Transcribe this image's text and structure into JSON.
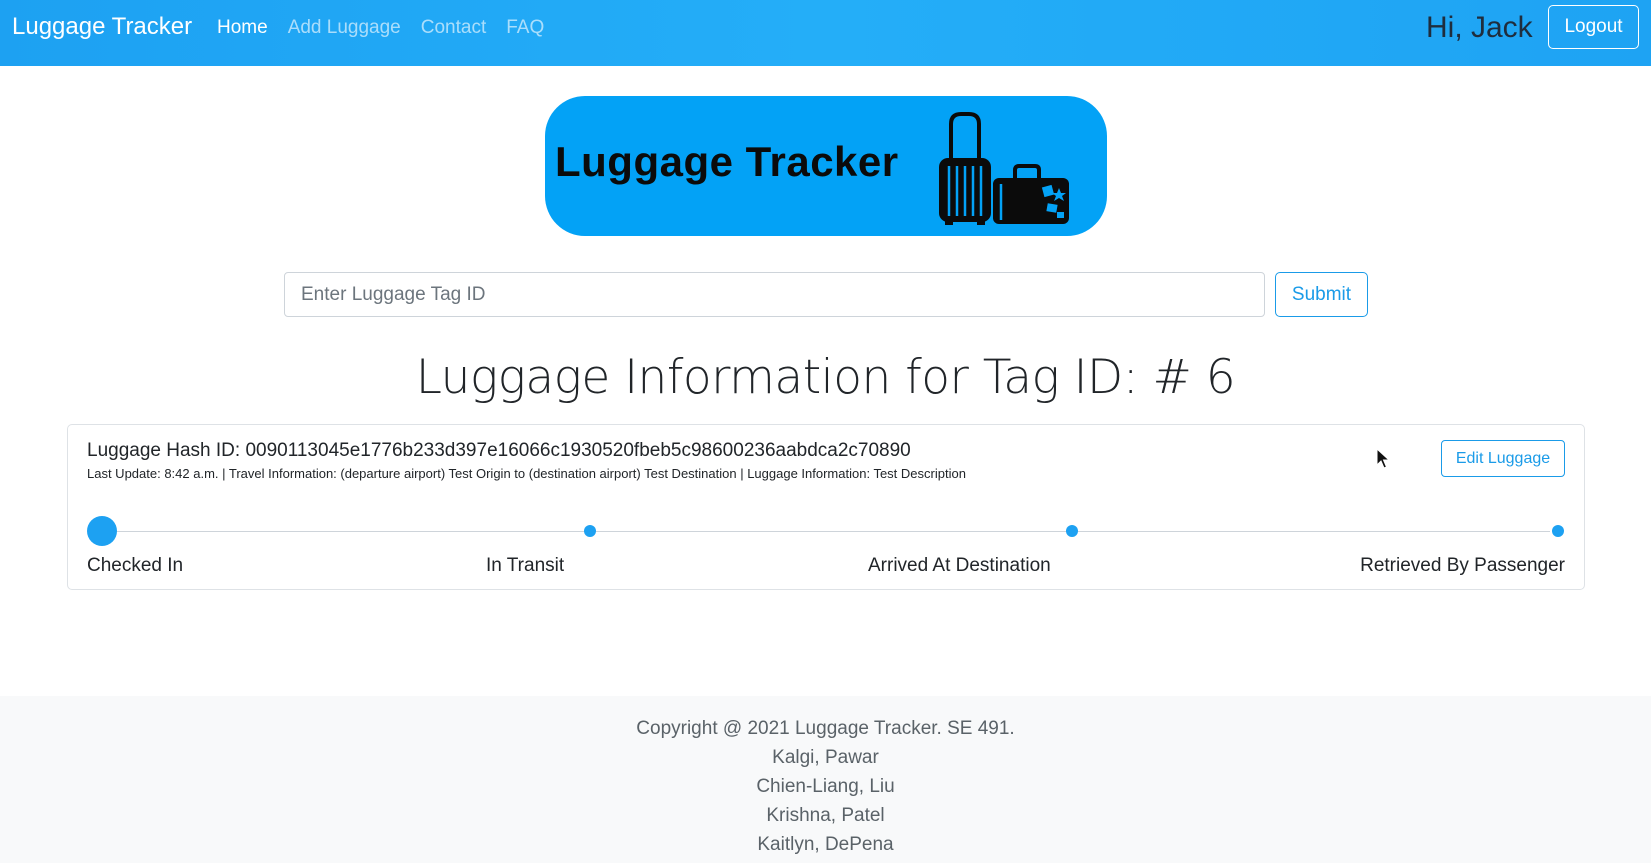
{
  "navbar": {
    "brand": "Luggage Tracker",
    "links": [
      {
        "label": "Home",
        "active": true
      },
      {
        "label": "Add Luggage",
        "active": false
      },
      {
        "label": "Contact",
        "active": false
      },
      {
        "label": "FAQ",
        "active": false
      }
    ],
    "greeting": "Hi, Jack",
    "logout_label": "Logout",
    "color": "#1da1f2"
  },
  "banner": {
    "text": "Luggage Tracker",
    "color": "#03a2f6",
    "icon": "luggage-icon"
  },
  "search": {
    "placeholder": "Enter Luggage Tag ID",
    "value": "",
    "submit_label": "Submit"
  },
  "page_title": "Luggage Information for Tag ID: # 6",
  "luggage": {
    "hash_line": "Luggage Hash ID: 0090113045e1776b233d397e16066c1930520fbeb5c98600236aabdca2c70890",
    "meta_line": "Last Update: 8:42 a.m. | Travel Information: (departure airport) Test Origin to (destination airport) Test Destination | Luggage Information: Test Description",
    "edit_label": "Edit Luggage",
    "current_step": 0,
    "steps": [
      {
        "label": "Checked In"
      },
      {
        "label": "In Transit"
      },
      {
        "label": "Arrived At Destination"
      },
      {
        "label": "Retrieved By Passenger"
      }
    ]
  },
  "footer": {
    "lines": [
      "Copyright @ 2021 Luggage Tracker. SE 491.",
      "Kalgi, Pawar",
      "Chien-Liang, Liu",
      "Krishna, Patel",
      "Kaitlyn, DePena"
    ]
  }
}
